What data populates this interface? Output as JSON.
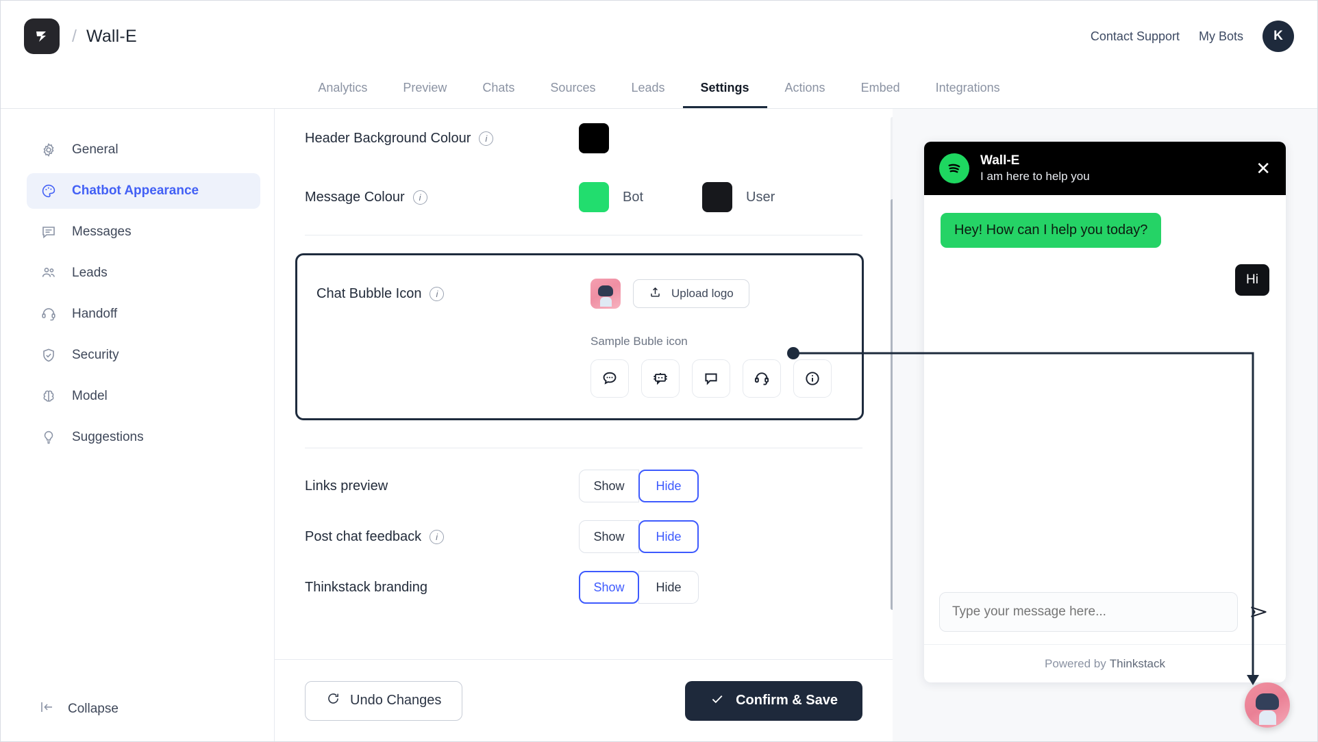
{
  "topbar": {
    "separator": "/",
    "bot_name": "Wall-E",
    "contact_support": "Contact Support",
    "my_bots": "My Bots",
    "avatar_initial": "K"
  },
  "tabs": [
    {
      "label": "Analytics",
      "active": false
    },
    {
      "label": "Preview",
      "active": false
    },
    {
      "label": "Chats",
      "active": false
    },
    {
      "label": "Sources",
      "active": false
    },
    {
      "label": "Leads",
      "active": false
    },
    {
      "label": "Settings",
      "active": true
    },
    {
      "label": "Actions",
      "active": false
    },
    {
      "label": "Embed",
      "active": false
    },
    {
      "label": "Integrations",
      "active": false
    }
  ],
  "sidebar": {
    "items": [
      {
        "label": "General",
        "icon": "gear-icon",
        "active": false
      },
      {
        "label": "Chatbot Appearance",
        "icon": "palette-icon",
        "active": true
      },
      {
        "label": "Messages",
        "icon": "message-icon",
        "active": false
      },
      {
        "label": "Leads",
        "icon": "people-icon",
        "active": false
      },
      {
        "label": "Handoff",
        "icon": "headset-icon",
        "active": false
      },
      {
        "label": "Security",
        "icon": "shield-check-icon",
        "active": false
      },
      {
        "label": "Model",
        "icon": "brain-icon",
        "active": false
      },
      {
        "label": "Suggestions",
        "icon": "lightbulb-icon",
        "active": false
      }
    ],
    "collapse_label": "Collapse"
  },
  "settings": {
    "header_background_colour": {
      "label": "Header Background Colour",
      "value": "#000000"
    },
    "message_colour": {
      "label": "Message Colour",
      "bot_label": "Bot",
      "bot_value": "#22DD6E",
      "user_label": "User",
      "user_value": "#17181C"
    },
    "chat_bubble_icon": {
      "label": "Chat Bubble Icon",
      "upload_label": "Upload logo",
      "sample_caption": "Sample Buble icon",
      "choices": [
        "speech-bubble-dots-icon",
        "robot-chat-icon",
        "speech-bubble-plain-icon",
        "headset-icon",
        "info-circle-icon"
      ]
    },
    "toggles": [
      {
        "label": "Links preview",
        "has_info": false,
        "options": [
          "Show",
          "Hide"
        ],
        "selected": "Hide"
      },
      {
        "label": "Post chat feedback",
        "has_info": true,
        "options": [
          "Show",
          "Hide"
        ],
        "selected": "Hide"
      },
      {
        "label": "Thinkstack branding",
        "has_info": false,
        "options": [
          "Show",
          "Hide"
        ],
        "selected": "Show"
      }
    ],
    "footer": {
      "undo_label": "Undo Changes",
      "save_label": "Confirm & Save"
    }
  },
  "chat_preview": {
    "header_title": "Wall-E",
    "header_subtitle": "I am here to help you",
    "close_icon": "✕",
    "messages": [
      {
        "sender": "bot",
        "text": "Hey! How can I help you today?"
      },
      {
        "sender": "user",
        "text": "Hi"
      }
    ],
    "input_placeholder": "Type your message here...",
    "powered_prefix": "Powered by",
    "powered_brand": "Thinkstack"
  }
}
